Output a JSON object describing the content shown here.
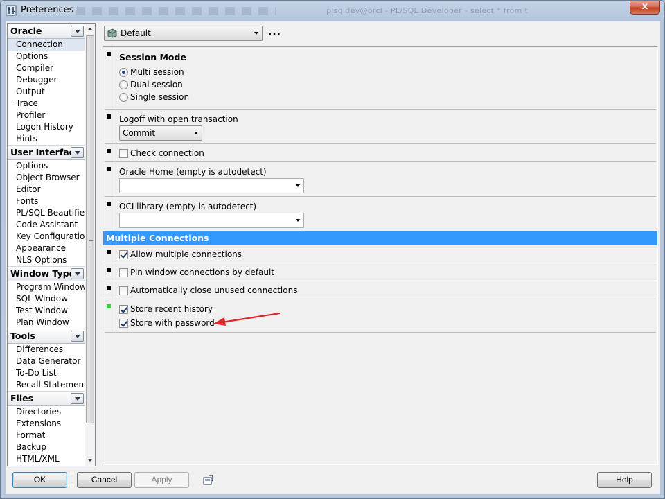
{
  "window": {
    "title": "Preferences",
    "close_glyph": "x",
    "ghost_text": "plsqldev@orcl - PL/SQL Developer - select * from t"
  },
  "sidebar": {
    "groups": [
      {
        "name": "Oracle",
        "items": [
          "Connection",
          "Options",
          "Compiler",
          "Debugger",
          "Output",
          "Trace",
          "Profiler",
          "Logon History",
          "Hints"
        ]
      },
      {
        "name": "User Interface",
        "items": [
          "Options",
          "Object Browser",
          "Editor",
          "Fonts",
          "PL/SQL Beautifier",
          "Code Assistant",
          "Key Configuration",
          "Appearance",
          "NLS Options"
        ]
      },
      {
        "name": "Window Types",
        "items": [
          "Program Window",
          "SQL Window",
          "Test Window",
          "Plan Window"
        ]
      },
      {
        "name": "Tools",
        "items": [
          "Differences",
          "Data Generator",
          "To-Do List",
          "Recall Statement"
        ]
      },
      {
        "name": "Files",
        "items": [
          "Directories",
          "Extensions",
          "Format",
          "Backup",
          "HTML/XML"
        ]
      }
    ],
    "selected": "Connection"
  },
  "profile": {
    "value": "Default",
    "more_label": "..."
  },
  "settings": {
    "session_mode": {
      "title": "Session Mode",
      "options": [
        "Multi session",
        "Dual session",
        "Single session"
      ],
      "selected": "Multi session"
    },
    "logoff": {
      "label": "Logoff with open transaction",
      "value": "Commit"
    },
    "check_connection": {
      "label": "Check connection",
      "checked": false
    },
    "oracle_home": {
      "label": "Oracle Home (empty is autodetect)",
      "value": ""
    },
    "oci_library": {
      "label": "OCI library (empty is autodetect)",
      "value": ""
    },
    "multiple_connections": {
      "title": "Multiple Connections",
      "allow_multiple": {
        "label": "Allow multiple connections",
        "checked": true
      },
      "pin_window": {
        "label": "Pin window connections by default",
        "checked": false
      },
      "auto_close": {
        "label": "Automatically close unused connections",
        "checked": false
      },
      "store_history": {
        "label": "Store recent history",
        "checked": true
      },
      "store_password": {
        "label": "Store with password",
        "checked": true
      }
    }
  },
  "buttons": {
    "ok": "OK",
    "cancel": "Cancel",
    "apply": "Apply",
    "help": "Help"
  },
  "colors": {
    "banner": "#3399ff",
    "modified_marker": "#34d33a",
    "annotation_arrow": "#e0262b"
  }
}
